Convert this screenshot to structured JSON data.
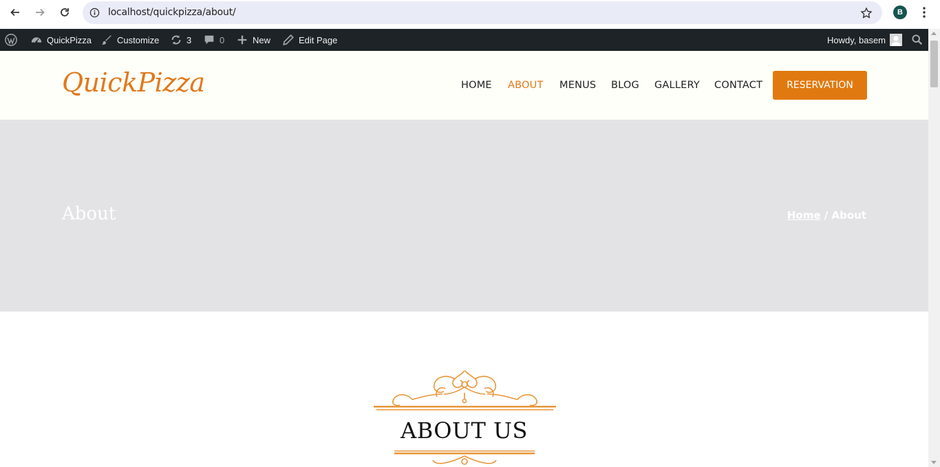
{
  "browser": {
    "url": "localhost/quickpizza/about/",
    "profile_initial": "B"
  },
  "admin_bar": {
    "site_name": "QuickPizza",
    "customize": "Customize",
    "updates_count": "3",
    "comments_count": "0",
    "new_label": "New",
    "edit_label": "Edit Page",
    "greeting": "Howdy, basem"
  },
  "header": {
    "logo": "QuickPizza",
    "menu": [
      "HOME",
      "ABOUT",
      "MENUS",
      "BLOG",
      "GALLERY",
      "CONTACT"
    ],
    "active_menu": "ABOUT",
    "cta": "RESERVATION",
    "accent_color": "#e1791c"
  },
  "hero": {
    "title": "About",
    "breadcrumb_home": "Home",
    "breadcrumb_sep": " / ",
    "breadcrumb_current": "About"
  },
  "section": {
    "title": "ABOUT US"
  }
}
